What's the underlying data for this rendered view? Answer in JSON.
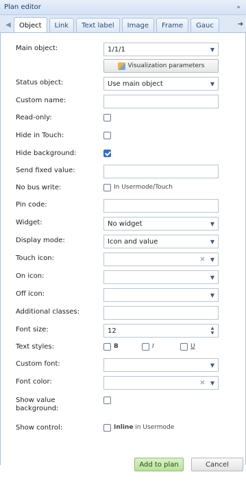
{
  "panel": {
    "title": "Plan editor",
    "collapse_icon": "»"
  },
  "tabs": [
    "Object",
    "Link",
    "Text label",
    "Image",
    "Frame",
    "Gauc"
  ],
  "form": {
    "main_object_label": "Main object:",
    "main_object_value": "1/1/1",
    "viz_button_label": "Visualization parameters",
    "status_object_label": "Status object:",
    "status_object_value": "Use main object",
    "custom_name_label": "Custom name:",
    "read_only_label": "Read-only:",
    "read_only_checked": false,
    "hide_touch_label": "Hide in Touch:",
    "hide_touch_checked": false,
    "hide_bg_label": "Hide background:",
    "hide_bg_checked": true,
    "send_fixed_label": "Send fixed value:",
    "no_bus_label": "No bus write:",
    "no_bus_checkbox_label": "In Usermode/Touch",
    "no_bus_checked": false,
    "pin_code_label": "Pin code:",
    "widget_label": "Widget:",
    "widget_value": "No widget",
    "display_mode_label": "Display mode:",
    "display_mode_value": "Icon and value",
    "touch_icon_label": "Touch icon:",
    "on_icon_label": "On icon:",
    "off_icon_label": "Off icon:",
    "additional_classes_label": "Additional classes:",
    "font_size_label": "Font size:",
    "font_size_value": "12",
    "text_styles_label": "Text styles:",
    "style_b": "B",
    "style_i": "I",
    "style_u": "U",
    "custom_font_label": "Custom font:",
    "font_color_label": "Font color:",
    "show_value_bg_label_1": "Show value",
    "show_value_bg_label_2": "background:",
    "show_value_bg_checked": false,
    "show_control_label": "Show control:",
    "inline_bold": "Inline",
    "inline_rest": " in Usermode"
  },
  "footer": {
    "add_label": "Add to plan",
    "cancel_label": "Cancel"
  }
}
